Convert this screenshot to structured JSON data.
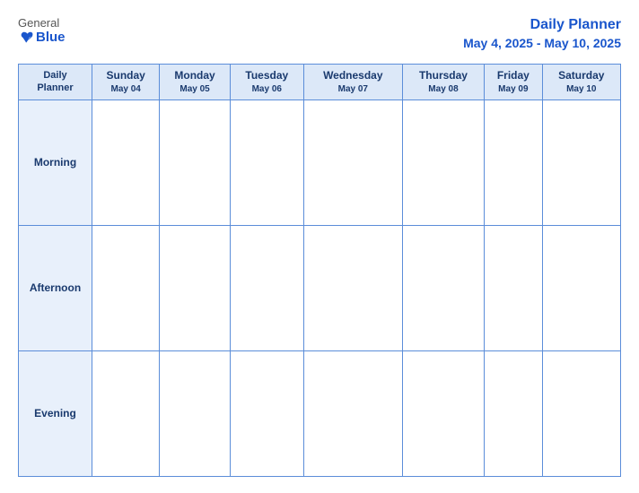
{
  "logo": {
    "general": "General",
    "blue": "Blue"
  },
  "header": {
    "title": "Daily Planner",
    "date_range": "May 4, 2025 - May 10, 2025"
  },
  "columns": [
    {
      "label": "Daily\nPlanner",
      "date": ""
    },
    {
      "label": "Sunday",
      "date": "May 04"
    },
    {
      "label": "Monday",
      "date": "May 05"
    },
    {
      "label": "Tuesday",
      "date": "May 06"
    },
    {
      "label": "Wednesday",
      "date": "May 07"
    },
    {
      "label": "Thursday",
      "date": "May 08"
    },
    {
      "label": "Friday",
      "date": "May 09"
    },
    {
      "label": "Saturday",
      "date": "May 10"
    }
  ],
  "rows": [
    {
      "label": "Morning"
    },
    {
      "label": "Afternoon"
    },
    {
      "label": "Evening"
    }
  ]
}
